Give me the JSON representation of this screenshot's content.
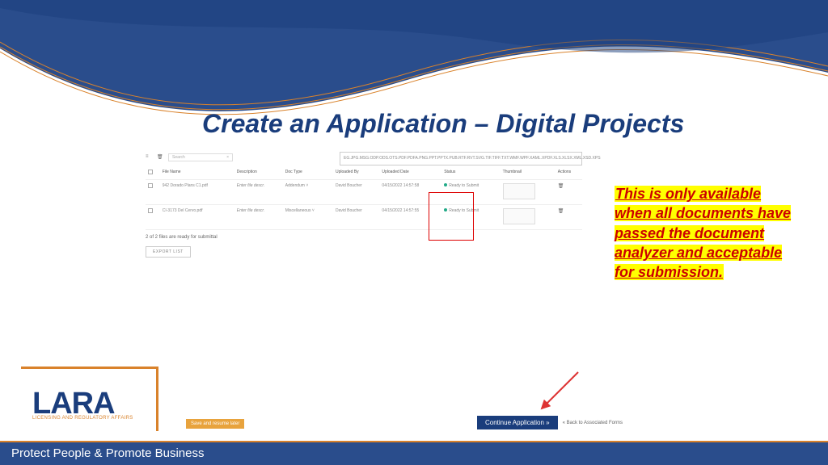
{
  "title": "Create an Application – Digital Projects",
  "formats": "EG.JPG.MSG.ODP.ODS.OTS.PDF.PDFA.PNG.PPT.PPTX.PUB.RTF.RVT.SVG.TIF.TIFF.TXT.WMF.WPF.XAML.XPDF.XLS.XLSX.XML.XSD.XPS",
  "search": {
    "placeholder": "Search",
    "clear": "×"
  },
  "headers": {
    "filename": "File Name",
    "description": "Description",
    "doctype": "Doc Type",
    "uploadedby": "Uploaded By",
    "uploadeddate": "Uploaded Date",
    "status": "Status",
    "thumbnail": "Thumbnail",
    "actions": "Actions"
  },
  "rows": [
    {
      "filename": "942 Dorado Plans C1.pdf",
      "description": "Enter file descr.",
      "doctype": "Addendum",
      "uploadedby": "David Boucher",
      "uploadeddate": "04/15/2022 14:57:58",
      "status": "Ready to Submit"
    },
    {
      "filename": "CI-3173 Del Cervo.pdf",
      "description": "Enter file descr.",
      "doctype": "Miscellaneous",
      "uploadedby": "David Boucher",
      "uploadeddate": "04/15/2022 14:57:55",
      "status": "Ready to Submit"
    }
  ],
  "ready_msg": "2 of 2 files are ready for submittal",
  "export_label": "EXPORT LIST",
  "callout": "This is only available when all documents have passed the document analyzer and acceptable for submission.",
  "logo": {
    "main": "LARA",
    "sub": "LICENSING AND REGULATORY AFFAIRS"
  },
  "save_label": "Save and resume later",
  "continue_label": "Continue Application »",
  "back_label": "« Back to Associated Forms",
  "footer": "Protect People & Promote Business"
}
